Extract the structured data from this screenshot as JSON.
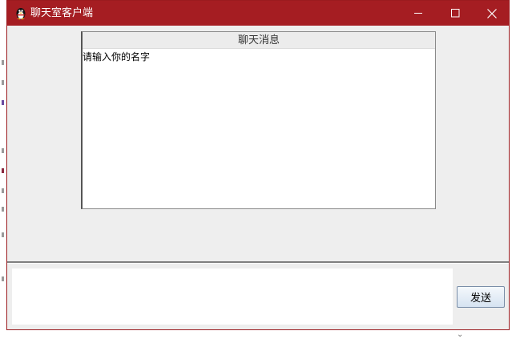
{
  "window": {
    "title": "聊天室客户端",
    "app_icon": "penguin-icon",
    "controls": {
      "minimize_icon": "minimize-icon",
      "maximize_icon": "maximize-icon",
      "close_icon": "close-icon"
    }
  },
  "chat": {
    "header": "聊天消息",
    "messages": [
      "请输入你的名字"
    ]
  },
  "composer": {
    "value": "",
    "send_label": "发送"
  },
  "colors": {
    "titlebar": "#a51d22",
    "window_bg": "#eeeeee",
    "panel_bg": "#ffffff"
  }
}
